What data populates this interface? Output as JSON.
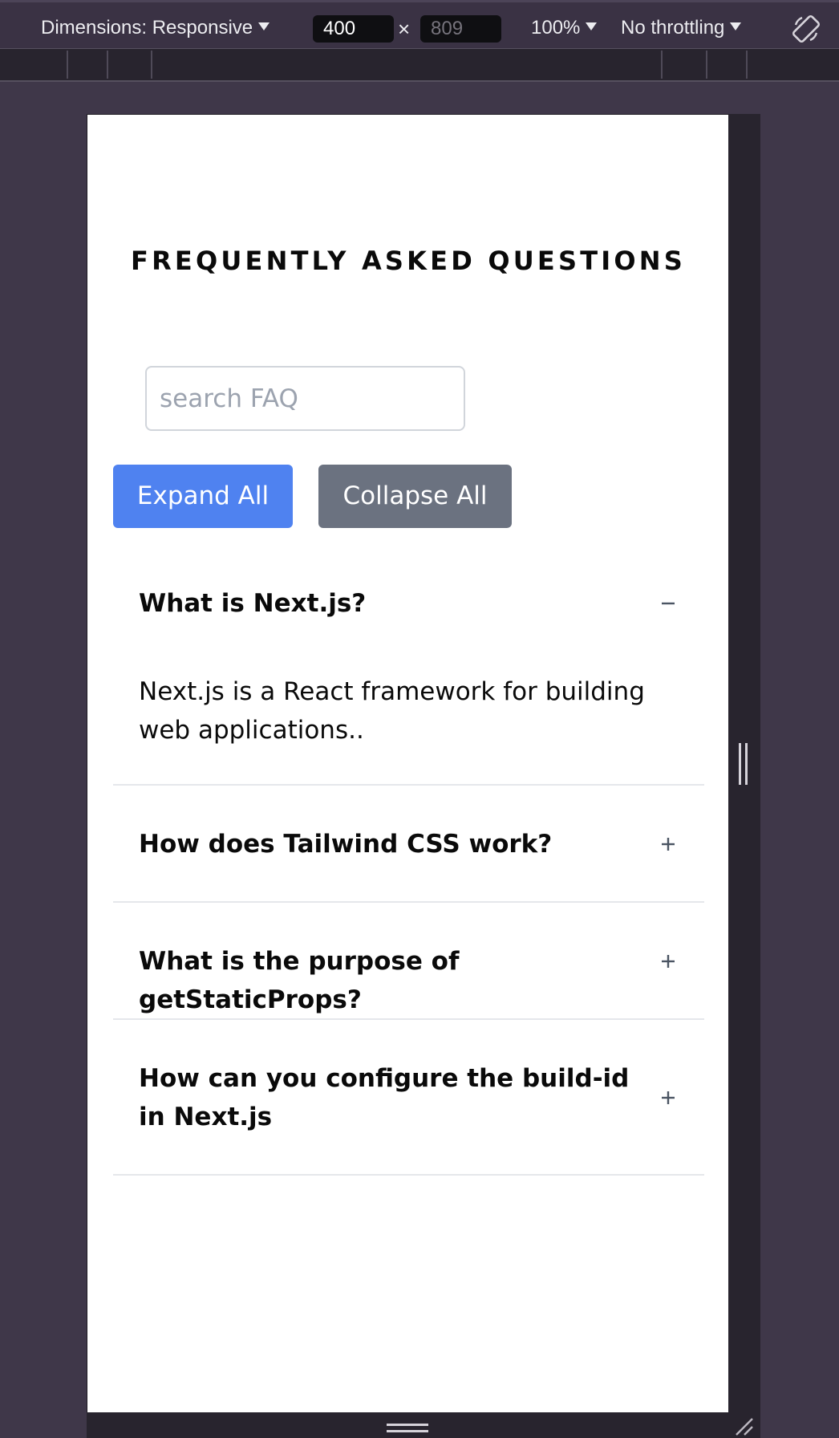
{
  "toolbar": {
    "dimensions_label": "Dimensions: Responsive",
    "width_value": "400",
    "height_value": "809",
    "times_symbol": "×",
    "zoom_label": "100%",
    "throttle_label": "No throttling"
  },
  "page": {
    "title": "FREQUENTLY ASKED QUESTIONS",
    "search_placeholder": "search FAQ",
    "expand_all_label": "Expand All",
    "collapse_all_label": "Collapse All"
  },
  "faqs": [
    {
      "question": "What is Next.js?",
      "answer": "Next.js is a React framework for building web applications..",
      "expanded": true
    },
    {
      "question": "How does Tailwind CSS work?",
      "expanded": false
    },
    {
      "question": "What is the purpose of getStaticProps?",
      "expanded": false
    },
    {
      "question": "How can you configure the build-id in Next.js",
      "expanded": false
    }
  ],
  "colors": {
    "expand_button": "#4f82f0",
    "collapse_button": "#6b7280",
    "devtools_background": "#3f3749",
    "page_background": "#ffffff"
  }
}
